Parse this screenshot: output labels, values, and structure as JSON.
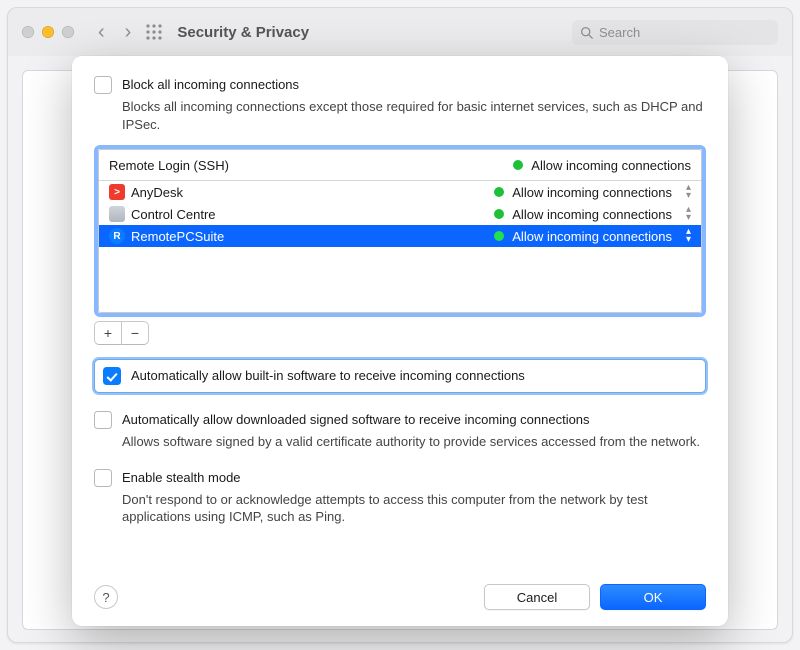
{
  "window": {
    "title": "Security & Privacy",
    "search_placeholder": "Search"
  },
  "sheet": {
    "block_all": {
      "checked": false,
      "label": "Block all incoming connections",
      "desc": "Blocks all incoming connections except those required for basic internet services, such as DHCP and IPSec."
    },
    "list": {
      "header": {
        "name": "Remote Login (SSH)",
        "status": "Allow incoming connections"
      },
      "rows": [
        {
          "name": "AnyDesk",
          "status": "Allow incoming connections",
          "icon": "anydesk",
          "selected": false
        },
        {
          "name": "Control Centre",
          "status": "Allow incoming connections",
          "icon": "cc",
          "selected": false
        },
        {
          "name": "RemotePCSuite",
          "status": "Allow incoming connections",
          "icon": "rpc",
          "selected": true
        }
      ]
    },
    "auto_builtin": {
      "checked": true,
      "label": "Automatically allow built-in software to receive incoming connections"
    },
    "auto_signed": {
      "checked": false,
      "label": "Automatically allow downloaded signed software to receive incoming connections",
      "desc": "Allows software signed by a valid certificate authority to provide services accessed from the network."
    },
    "stealth": {
      "checked": false,
      "label": "Enable stealth mode",
      "desc": "Don't respond to or acknowledge attempts to access this computer from the network by test applications using ICMP, such as Ping."
    },
    "buttons": {
      "cancel": "Cancel",
      "ok": "OK"
    }
  }
}
